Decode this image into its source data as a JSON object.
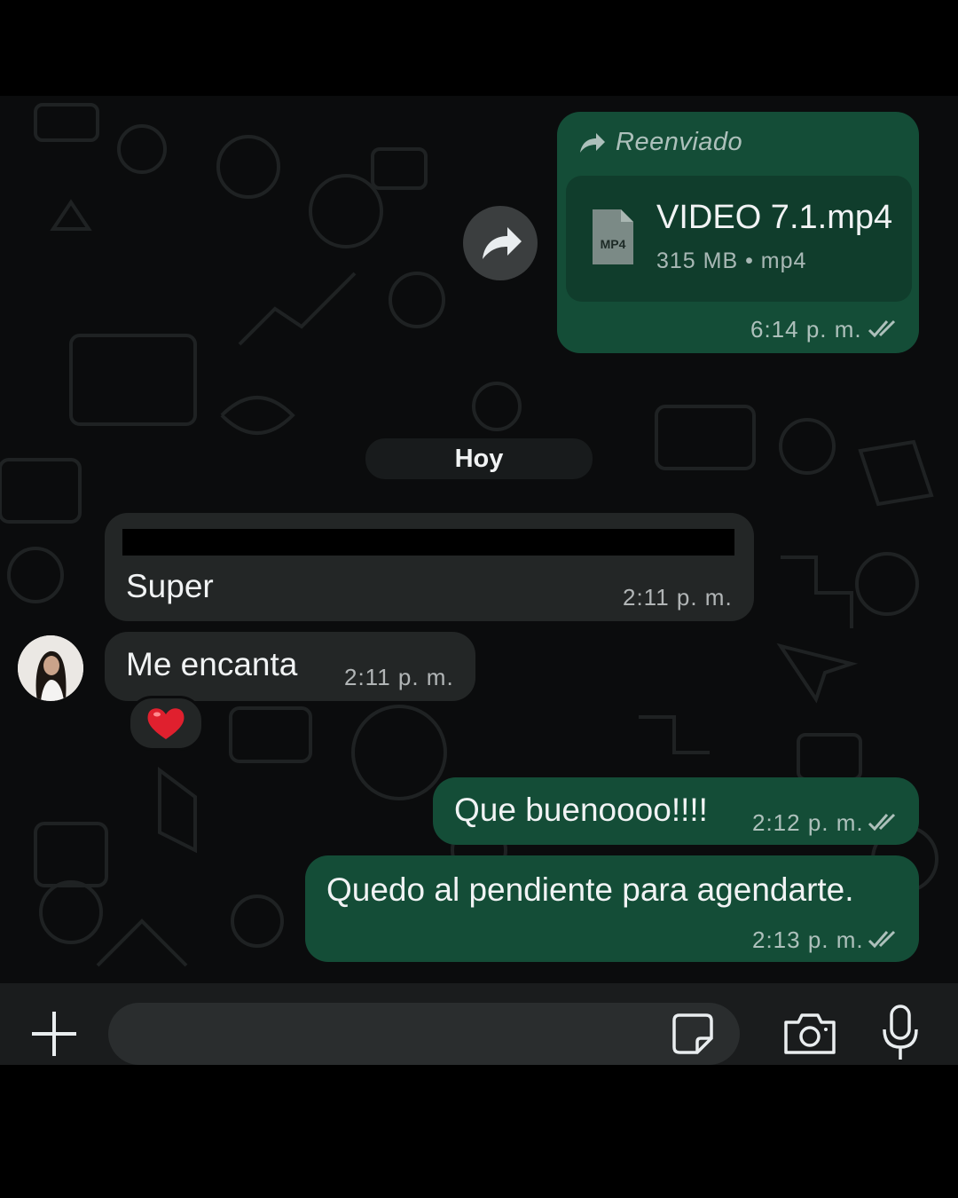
{
  "conversation": {
    "forwarded": {
      "label": "Reenviado",
      "file_badge": "MP4",
      "file_name": "VIDEO 7.1.mp4",
      "file_meta": "315 MB • mp4",
      "time": "6:14 p. m."
    },
    "date_separator": "Hoy",
    "incoming": [
      {
        "text": "Super",
        "time": "2:11 p. m."
      },
      {
        "text": "Me  encanta",
        "time": "2:11 p. m.",
        "reaction": "❤️"
      }
    ],
    "outgoing": [
      {
        "text": "Que buenoooo!!!!",
        "time": "2:12 p. m."
      },
      {
        "text": "Quedo al pendiente para agendarte.",
        "time": "2:13 p. m."
      }
    ]
  },
  "icons": {
    "forward": "forward-arrow-icon",
    "share": "share-icon",
    "ticks": "double-check-icon",
    "plus": "plus-icon",
    "sticker": "sticker-icon",
    "camera": "camera-icon",
    "mic": "microphone-icon"
  },
  "colors": {
    "outgoing_bubble": "#144d37",
    "incoming_bubble": "#232626",
    "background": "#0b0c0d",
    "reaction_heart": "#e0202e"
  }
}
